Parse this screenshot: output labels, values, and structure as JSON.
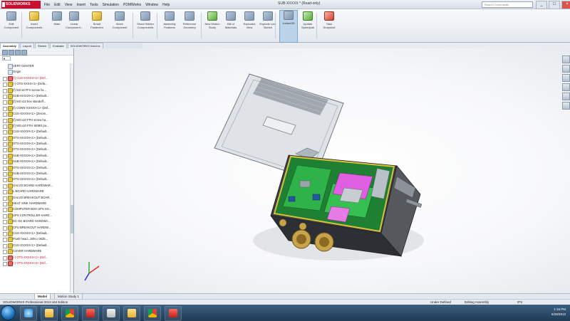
{
  "app": {
    "logo_text": "SOLIDWORKS",
    "menu": [
      "File",
      "Edit",
      "View",
      "Insert",
      "Tools",
      "Simulation",
      "PDMWorks",
      "Window",
      "Help"
    ],
    "document_title": "SUB-XXXXX * (Read-only)",
    "search_placeholder": "Search Commands",
    "window_buttons": [
      "_",
      "□",
      "×"
    ]
  },
  "ribbon": {
    "buttons": [
      {
        "label": "Edit Component",
        "color": "blue"
      },
      {
        "label": "Insert Components",
        "color": "yellow"
      },
      {
        "label": "Mate",
        "color": "blue"
      },
      {
        "label": "Linear Component...",
        "color": "blue"
      },
      {
        "label": "Smart Fasteners",
        "color": "yellow"
      },
      {
        "label": "Move Component",
        "color": "blue"
      },
      {
        "label": "Show Hidden Components",
        "color": "blue"
      },
      {
        "label": "Assembly Features",
        "color": "blue"
      },
      {
        "label": "Reference Geometry",
        "color": "blue"
      },
      {
        "label": "New Motion Study",
        "color": "green"
      },
      {
        "label": "Bill of Materials",
        "color": "blue"
      },
      {
        "label": "Exploded View",
        "color": "blue"
      },
      {
        "label": "Explode Line Sketch",
        "color": "blue"
      },
      {
        "label": "Instant3D",
        "color": "blue"
      },
      {
        "label": "Update Speedpak",
        "color": "green"
      },
      {
        "label": "Take Snapshot",
        "color": "red"
      }
    ],
    "selected_index": 13
  },
  "command_tabs": [
    "Assembly",
    "Layout",
    "Sketch",
    "Evaluate",
    "SOLIDWORKS Add-Ins"
  ],
  "tree": {
    "filter_glyph": "▼",
    "items": [
      {
        "label": "VERT-CENTER",
        "state": "plain"
      },
      {
        "label": "Origin",
        "state": "plain"
      },
      {
        "label": "(f) CUS-XXXXX<1> (Def...",
        "state": "err"
      },
      {
        "label": "(-) OTS-XXXX<1> (Defa...",
        "state": "normal"
      },
      {
        "label": "(f) M3 x8 FFH screw hx...",
        "state": "normal"
      },
      {
        "label": "SUB-XXXXX<1> (Default...",
        "state": "normal"
      },
      {
        "label": "(f) M3 x12 hex standoff...",
        "state": "normal"
      },
      {
        "label": "(f) CONN-XXXXX<1> (Def...",
        "state": "normal"
      },
      {
        "label": "CUS-XXXXX<1> (Zerom...",
        "state": "normal"
      },
      {
        "label": "(f) M3 x10 FFH screw ha...",
        "state": "normal"
      },
      {
        "label": "(f) M3 x10 FFH SEMS pa...",
        "state": "normal"
      },
      {
        "label": "CUS-XXXXX<1> (Default...",
        "state": "normal"
      },
      {
        "label": "OTS-XXXXX<1> (Default...",
        "state": "normal"
      },
      {
        "label": "OTS-XXXXX<1> (Default...",
        "state": "normal"
      },
      {
        "label": "OTS-XXXXX<1> (Default...",
        "state": "normal"
      },
      {
        "label": "SUB-XXXXX<1> (Default...",
        "state": "normal"
      },
      {
        "label": "SUB-XXXXX<1> (Default...",
        "state": "normal"
      },
      {
        "label": "OTS-XXXXX<1> (Default...",
        "state": "normal"
      },
      {
        "label": "SUB-XXXXX<1> (Default...",
        "state": "normal"
      },
      {
        "label": "OTS-XXXXX<1> (Default...",
        "state": "normal"
      },
      {
        "label": "GALVO BOARD HARDWAR...",
        "state": "normal"
      },
      {
        "label": "L BOARD HARDWARE",
        "state": "normal"
      },
      {
        "label": "GALVO BREAKOUT BOAR...",
        "state": "normal"
      },
      {
        "label": "HEAT SINK HARDWARE",
        "state": "normal"
      },
      {
        "label": "COMPUTER BOX UPS SH...",
        "state": "normal"
      },
      {
        "label": "UPS CONTROLLER HARD...",
        "state": "normal"
      },
      {
        "label": "DC-DC BOARD HARDWA...",
        "state": "normal"
      },
      {
        "label": "CPU BREAKOUT HARDW...",
        "state": "normal"
      },
      {
        "label": "CUS-XXXXX<1> (Default...",
        "state": "normal"
      },
      {
        "label": "Flush head...25N x 0625...",
        "state": "normal"
      },
      {
        "label": "CUS-XXXXX<1> (Default...",
        "state": "normal"
      },
      {
        "label": "COVER HARDWARE",
        "state": "normal"
      },
      {
        "label": "(-) OTS-XXXXX<1> (Def...",
        "state": "err"
      },
      {
        "label": "(-) OTS-XXXXX<2> (Def...",
        "state": "err"
      }
    ]
  },
  "model_tabs": [
    "Model",
    "Motion Study 1"
  ],
  "status": {
    "left": "SOLIDWORKS Professional 2013 x64 Edition",
    "center": "Under Defined",
    "right": "Editing Assembly",
    "units": "IPS"
  },
  "taskbar": {
    "apps": [
      "ie",
      "folder",
      "chrome",
      "solidworks",
      "grey",
      "folder",
      "chrome",
      "solidworks"
    ],
    "time": "1:16 PM",
    "date": "5/28/2013"
  },
  "colors": {
    "pcb_green": "#2fb24a",
    "pink_part": "#e05fe0",
    "lid_grey": "#d8dde2",
    "accent": "#c8102e"
  }
}
